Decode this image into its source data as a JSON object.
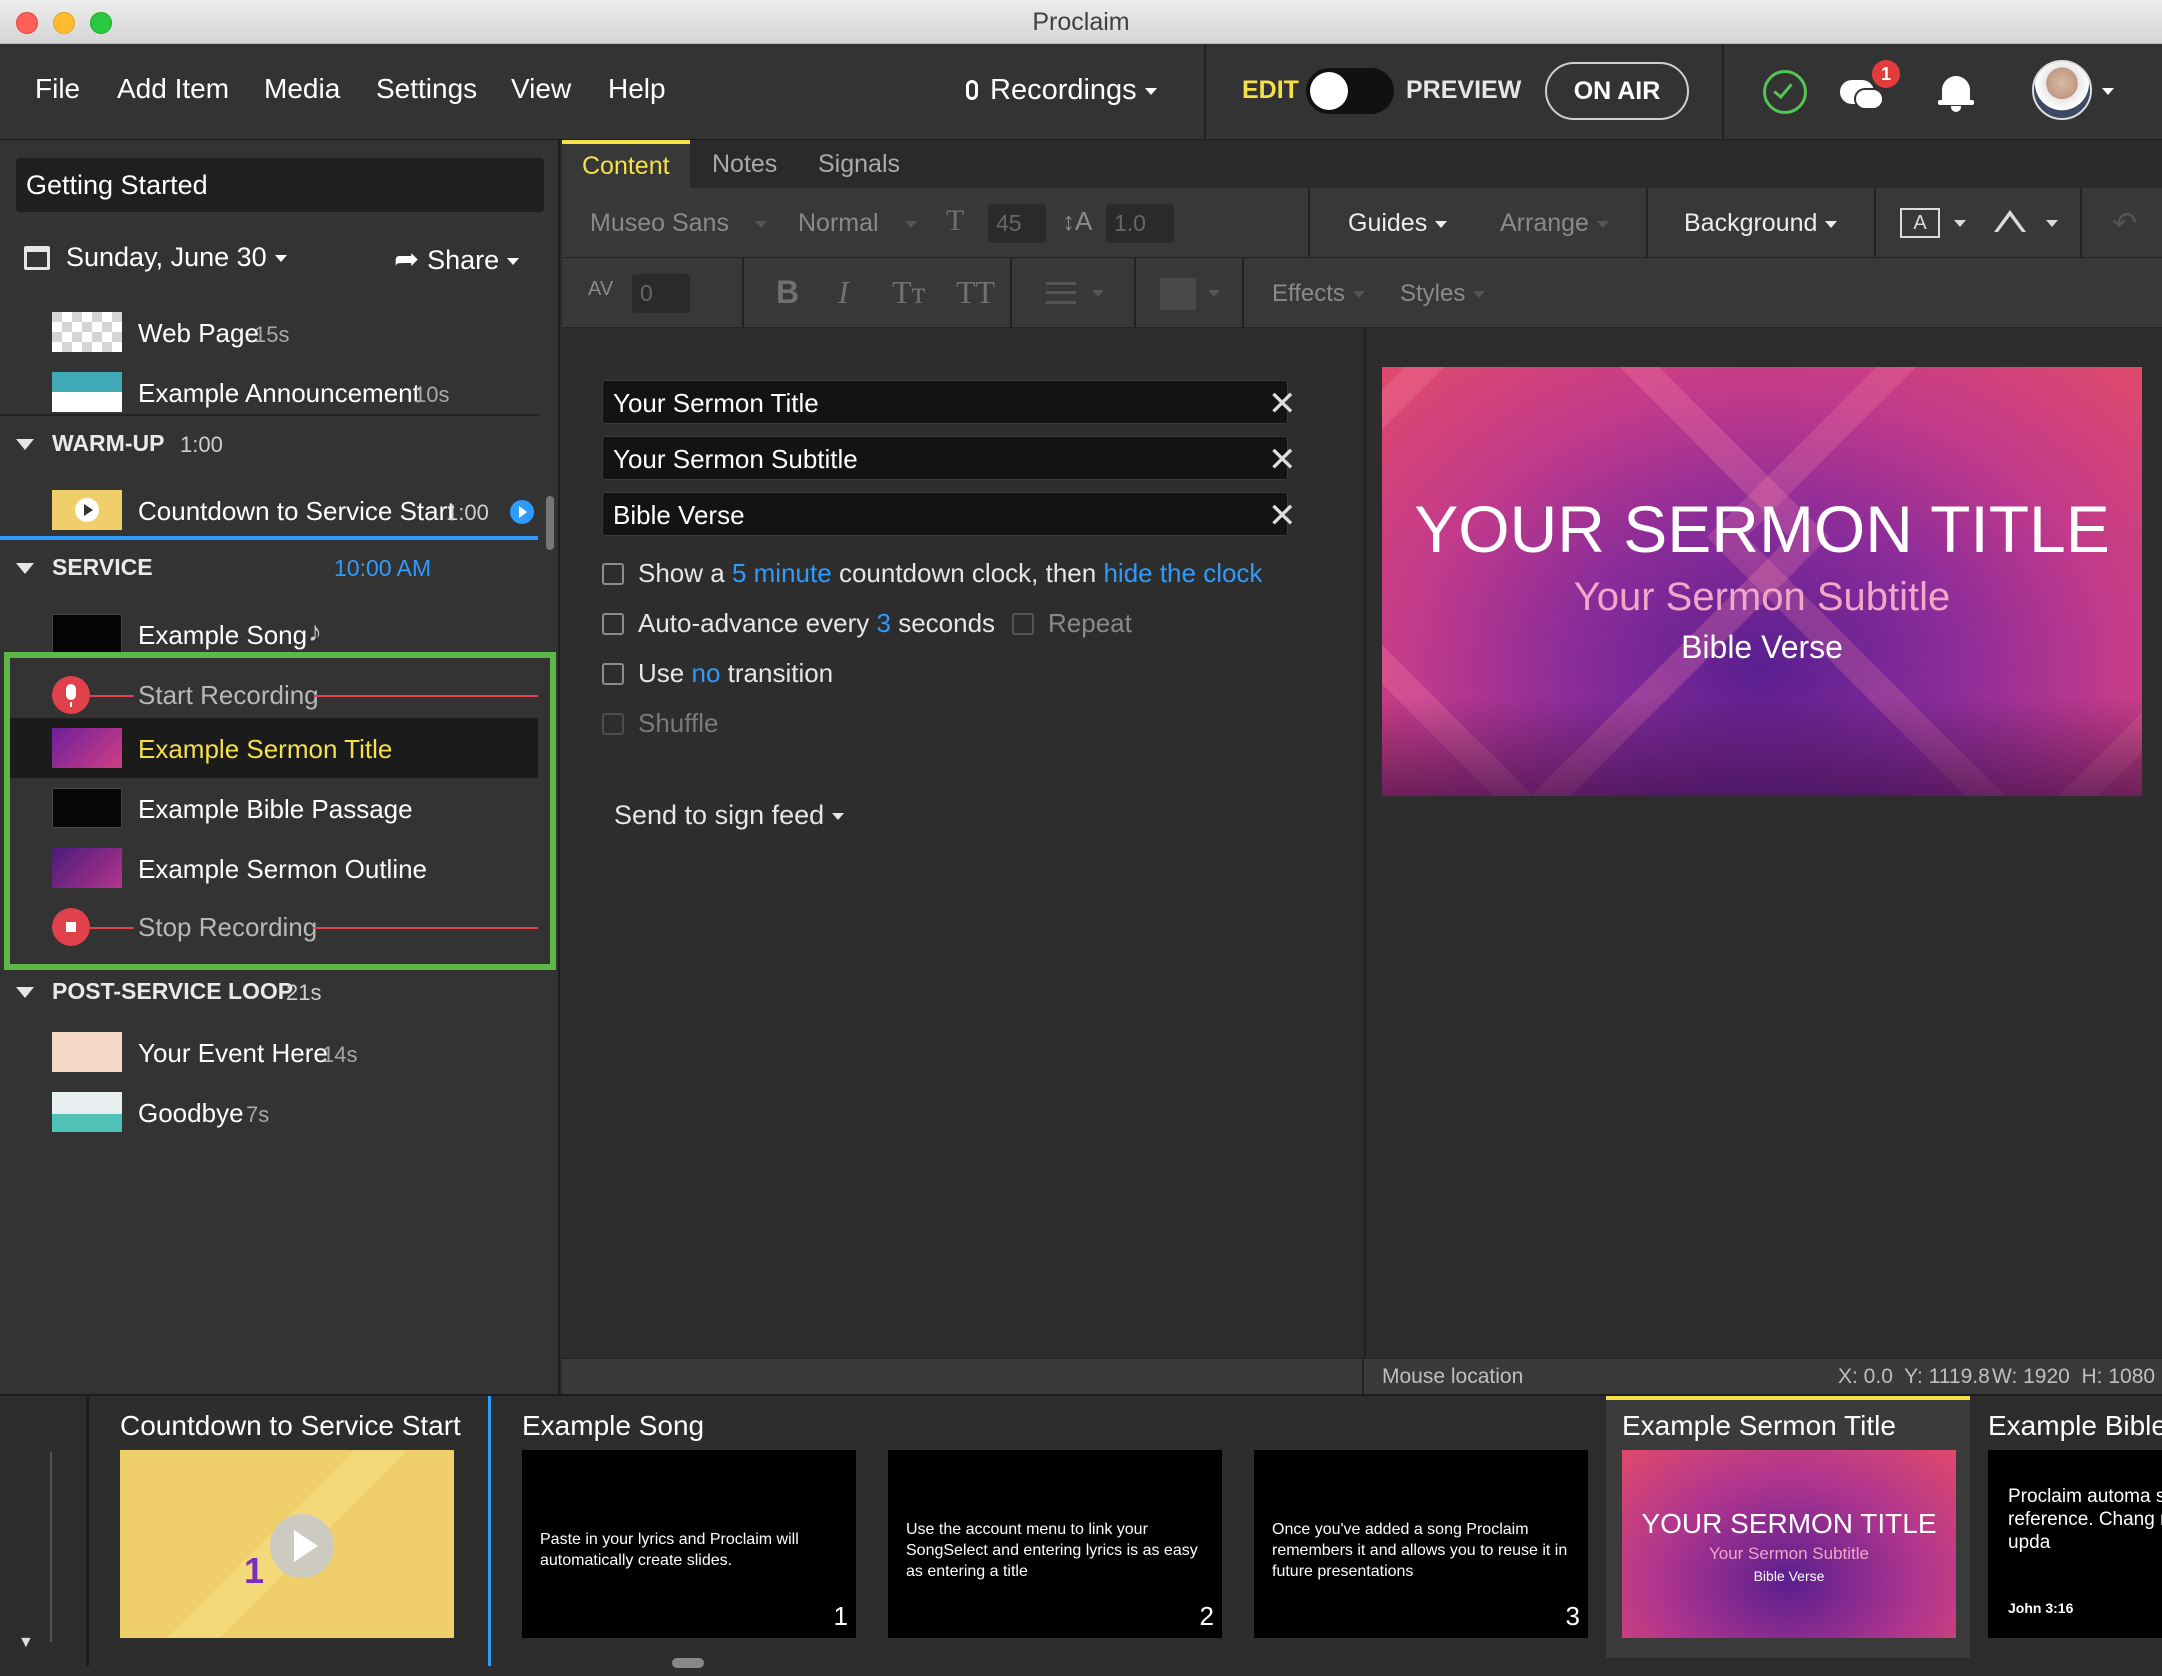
{
  "app": {
    "title": "Proclaim"
  },
  "menu": [
    "File",
    "Add Item",
    "Media",
    "Settings",
    "View",
    "Help"
  ],
  "header": {
    "recordings_label": "Recordings",
    "edit_label": "EDIT",
    "preview_label": "PREVIEW",
    "onair_label": "ON AIR",
    "notification_count": "1"
  },
  "presentation": {
    "name": "Getting Started",
    "date": "Sunday, June 30",
    "share_label": "Share"
  },
  "items": {
    "webpage": {
      "title": "Web Page",
      "dur": "15s"
    },
    "announcement": {
      "title": "Example Announcement",
      "dur": "10s"
    },
    "warmup": {
      "title": "WARM-UP",
      "dur": "1:00"
    },
    "countdown": {
      "title": "Countdown to Service Start",
      "dur": "1:00"
    },
    "service": {
      "title": "SERVICE",
      "time": "10:00 AM"
    },
    "song": {
      "title": "Example Song"
    },
    "start_rec": {
      "title": "Start Recording"
    },
    "sermon_title": {
      "title": "Example Sermon Title"
    },
    "bible": {
      "title": "Example Bible Passage"
    },
    "outline": {
      "title": "Example Sermon Outline"
    },
    "stop_rec": {
      "title": "Stop Recording"
    },
    "postloop": {
      "title": "POST-SERVICE LOOP",
      "dur": "21s"
    },
    "event": {
      "title": "Your Event Here",
      "dur": "14s"
    },
    "goodbye": {
      "title": "Goodbye",
      "dur": "7s"
    }
  },
  "tabs": [
    "Content",
    "Notes",
    "Signals"
  ],
  "toolbar": {
    "font": "Museo Sans",
    "weight": "Normal",
    "size": "45",
    "line_height": "1.0",
    "guides": "Guides",
    "arrange": "Arrange",
    "background": "Background",
    "spacing": "0",
    "bold": "B",
    "italic": "I",
    "smallcaps": "Tт",
    "caps": "TT",
    "effects": "Effects",
    "styles": "Styles"
  },
  "fields": {
    "title": "Your Sermon Title",
    "subtitle": "Your Sermon Subtitle",
    "verse": "Bible Verse"
  },
  "options": {
    "countdown_pre": "Show a",
    "countdown_val": "5 minute",
    "countdown_mid": "countdown clock, then",
    "countdown_link": "hide the clock",
    "advance_pre": "Auto-advance every",
    "advance_val": "3",
    "advance_post": "seconds",
    "repeat": "Repeat",
    "use_pre": "Use",
    "use_val": "no",
    "use_post": "transition",
    "shuffle": "Shuffle",
    "send": "Send to sign feed"
  },
  "slide": {
    "title": "YOUR SERMON TITLE",
    "subtitle": "Your Sermon Subtitle",
    "verse": "Bible Verse"
  },
  "statusbar": {
    "label": "Mouse location",
    "coords": "X: 0.0  Y: 1119.8",
    "dims": "W: 1920  H: 1080"
  },
  "filmstrip": {
    "countdown": {
      "label": "Countdown to Service Start"
    },
    "song": {
      "label": "Example Song",
      "slides": [
        {
          "text": "Paste in your lyrics and Proclaim will  automatically create slides.",
          "num": "1"
        },
        {
          "text": "Use the account menu to link your SongSelect and entering lyrics is as easy as entering a title",
          "num": "2"
        },
        {
          "text": "Once you've added a song Proclaim remembers it and allows you to reuse it in future presentations",
          "num": "3"
        }
      ]
    },
    "sermon": {
      "label": "Example Sermon Title",
      "title": "YOUR SERMON TITLE",
      "subtitle": "Your Sermon Subtitle",
      "verse": "Bible Verse"
    },
    "bible": {
      "label": "Example Bible",
      "text": "Proclaim automa slides when you e reference. Chang reference to upda",
      "ref": "John 3:16"
    }
  },
  "colors": {
    "accent": "#f5e04a",
    "link": "#2f9bff",
    "selection": "#5db84a",
    "recording": "#e0414b"
  }
}
